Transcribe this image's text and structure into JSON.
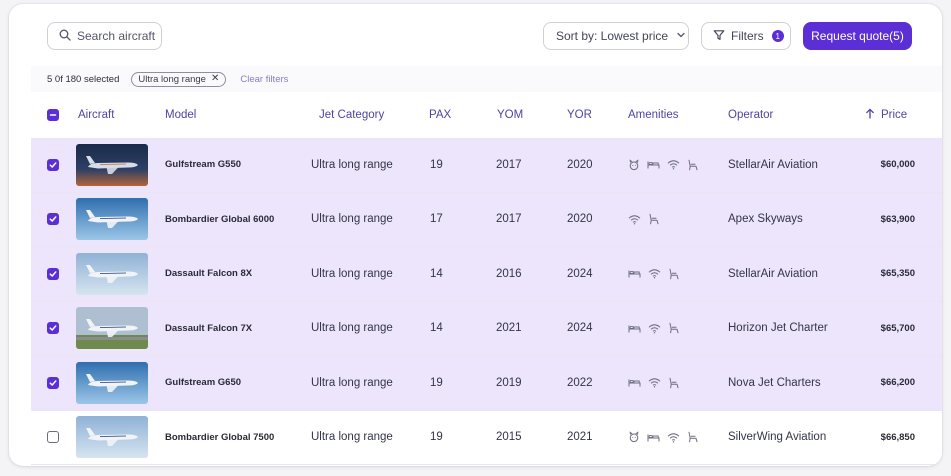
{
  "toolbar": {
    "search_placeholder": "Search aircraft",
    "sort_label": "Sort by: Lowest price",
    "filters_label": "Filters",
    "filters_count": "1",
    "quote_label": "Request quote(5)"
  },
  "selection": {
    "summary": "5 0f 180 selected",
    "chip_label": "Ultra long range",
    "clear_label": "Clear filters"
  },
  "table": {
    "headers": {
      "aircraft": "Aircraft",
      "model": "Model",
      "category": "Jet Category",
      "pax": "PAX",
      "yom": "YOM",
      "yor": "YOR",
      "amenities": "Amenities",
      "operator": "Operator",
      "price": "Price"
    },
    "rows": [
      {
        "selected": true,
        "model": "Gulfstream G550",
        "category": "Ultra long range",
        "pax": "19",
        "yom": "2017",
        "yor": "2020",
        "amenities": [
          "pet-icon",
          "bed-icon",
          "wifi-icon",
          "seat-icon"
        ],
        "operator": "StellarAir Aviation",
        "price": "$60,000",
        "sky": "night"
      },
      {
        "selected": true,
        "model": "Bombardier Global 6000",
        "category": "Ultra long range",
        "pax": "17",
        "yom": "2017",
        "yor": "2020",
        "amenities": [
          "wifi-icon",
          "seat-icon"
        ],
        "operator": "Apex Skyways",
        "price": "$63,900",
        "sky": "blue"
      },
      {
        "selected": true,
        "model": "Dassault Falcon 8X",
        "category": "Ultra long range",
        "pax": "14",
        "yom": "2016",
        "yor": "2024",
        "amenities": [
          "bed-icon",
          "wifi-icon",
          "seat-icon"
        ],
        "operator": "StellarAir Aviation",
        "price": "$65,350",
        "sky": "light"
      },
      {
        "selected": true,
        "model": "Dassault Falcon 7X",
        "category": "Ultra long range",
        "pax": "14",
        "yom": "2021",
        "yor": "2024",
        "amenities": [
          "bed-icon",
          "wifi-icon",
          "seat-icon"
        ],
        "operator": "Horizon Jet Charter",
        "price": "$65,700",
        "sky": "ground"
      },
      {
        "selected": true,
        "model": "Gulfstream G650",
        "category": "Ultra long range",
        "pax": "19",
        "yom": "2019",
        "yor": "2022",
        "amenities": [
          "bed-icon",
          "wifi-icon",
          "seat-icon"
        ],
        "operator": "Nova Jet Charters",
        "price": "$66,200",
        "sky": "blue"
      },
      {
        "selected": false,
        "model": "Bombardier Global 7500",
        "category": "Ultra long range",
        "pax": "19",
        "yom": "2015",
        "yor": "2021",
        "amenities": [
          "pet-icon",
          "bed-icon",
          "wifi-icon",
          "seat-icon"
        ],
        "operator": "SilverWing Aviation",
        "price": "$66,850",
        "sky": "light"
      }
    ]
  },
  "colors": {
    "accent": "#5b2ed6",
    "selected_row": "#ece5fb",
    "header_text": "#4a46a3"
  }
}
